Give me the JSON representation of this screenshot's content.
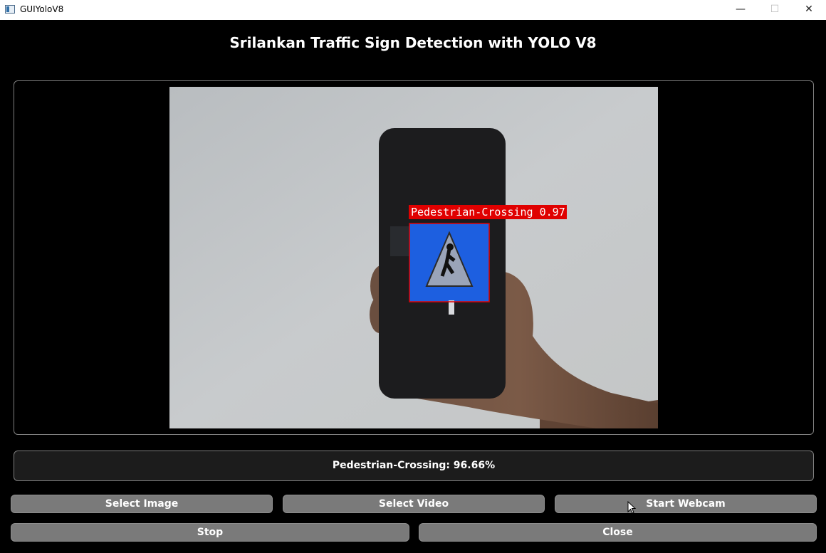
{
  "window": {
    "title": "GUIYoloV8",
    "minimize_glyph": "—",
    "maximize_glyph": "☐",
    "close_glyph": "✕"
  },
  "app": {
    "title": "Srilankan Traffic Sign Detection with YOLO V8"
  },
  "detection": {
    "label": "Pedestrian-Crossing 0.97",
    "box_color": "#e00000"
  },
  "result": {
    "text": "Pedestrian-Crossing: 96.66%"
  },
  "buttons": {
    "select_image": "Select Image",
    "select_video": "Select Video",
    "start_webcam": "Start Webcam",
    "stop": "Stop",
    "close": "Close"
  }
}
